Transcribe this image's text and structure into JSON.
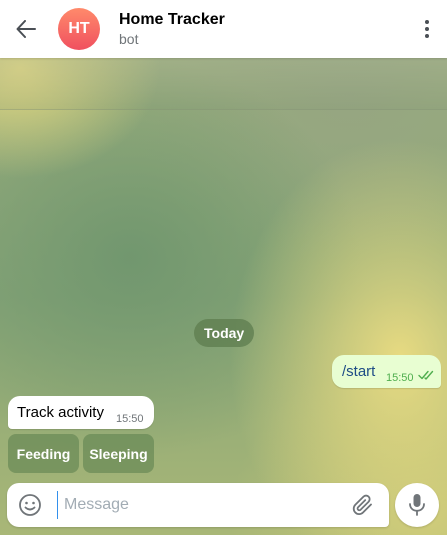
{
  "header": {
    "back_icon": "arrow-left-icon",
    "avatar_initials": "HT",
    "title": "Home Tracker",
    "subtitle": "bot",
    "menu_icon": "more-vertical-icon"
  },
  "chat": {
    "date_separator": "Today",
    "messages": [
      {
        "direction": "outgoing",
        "text": "/start",
        "time": "15:50",
        "status": "read"
      },
      {
        "direction": "incoming",
        "text": "Track activity",
        "time": "15:50"
      }
    ],
    "keyboard_buttons": [
      "Feeding",
      "Sleeping"
    ]
  },
  "composer": {
    "emoji_icon": "smile-icon",
    "placeholder": "Message",
    "value": "",
    "attach_icon": "paperclip-icon",
    "mic_icon": "microphone-icon"
  },
  "colors": {
    "avatar_gradient_top": "#ff8a6b",
    "avatar_gradient_bottom": "#f0505f",
    "outgoing_bubble": "#e8fed2",
    "incoming_bubble": "#ffffff",
    "read_checks": "#4fae4e",
    "caret": "#3390ec"
  }
}
